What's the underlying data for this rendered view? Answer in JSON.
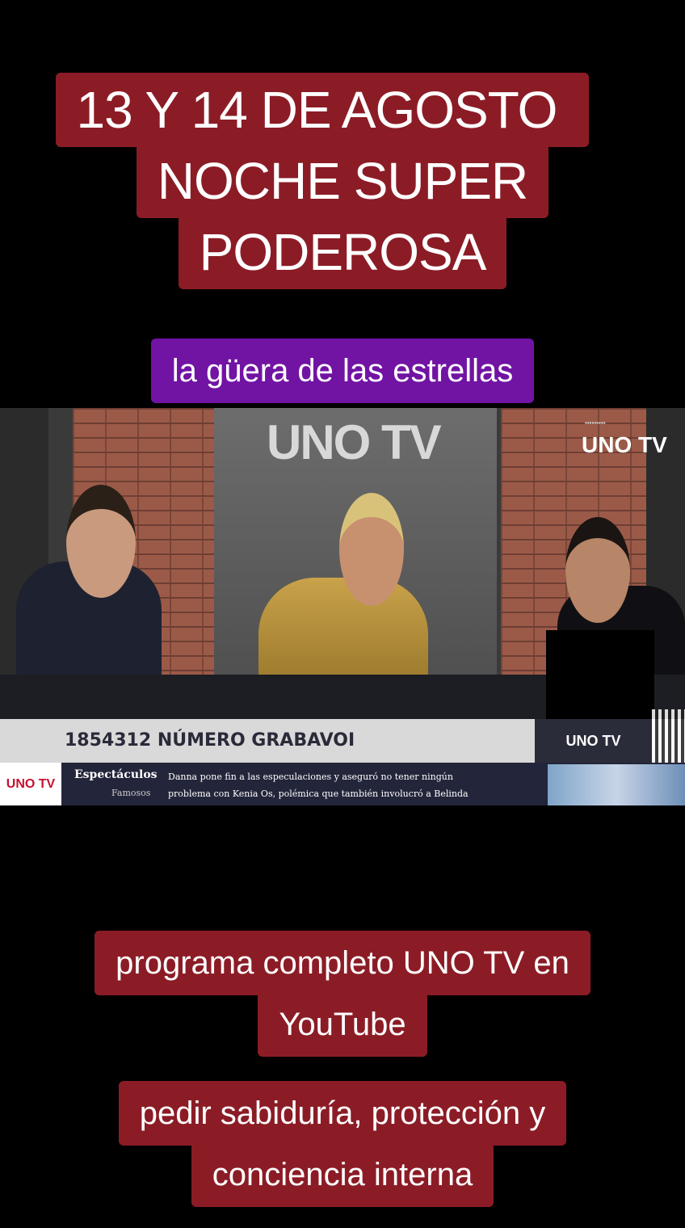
{
  "title": {
    "line1": "13 Y 14 DE AGOSTO",
    "line2": "NOCHE SUPER",
    "line3": "PODEROSA"
  },
  "subtitle": "la güera de las estrellas",
  "video": {
    "wall_logo": "UNO TV",
    "corner_logo": "UNO TV",
    "ticker_number": "1854312 NÚMERO GRABAVOI",
    "ticker_logo": "UNO TV",
    "bottom_logo": "UNO TV",
    "section": "Espectáculos",
    "subsection": "Famosos",
    "headline_line1": "Danna pone fin a las especulaciones y aseguró no tener ningún",
    "headline_line2": "problema con Kenia Os, polémica que también involucró a Belinda"
  },
  "caption2": {
    "line1": "programa completo UNO TV en",
    "line2": "YouTube"
  },
  "caption3": {
    "line1": "pedir sabiduría, protección y",
    "line2": "conciencia interna"
  },
  "colors": {
    "caption_red": "#8b1c26",
    "caption_purple": "#7113a3"
  }
}
